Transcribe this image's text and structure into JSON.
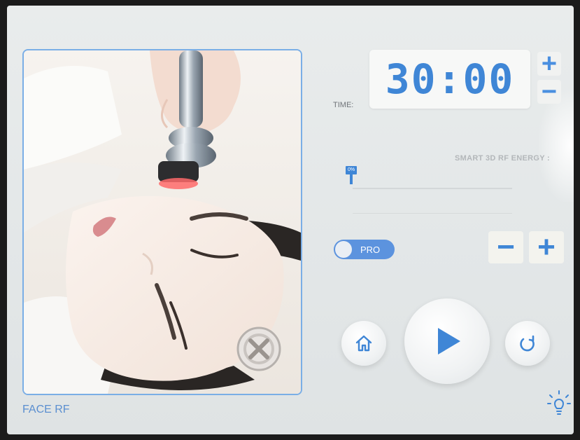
{
  "treatment": {
    "mode_label": "FACE RF"
  },
  "timer": {
    "label": "TIME:",
    "value": "30:00",
    "increment_label": "+",
    "decrement_label": "−"
  },
  "energy": {
    "label": "SMART 3D RF ENERGY :",
    "level_text": "0%",
    "level_fraction": 0.0,
    "decrease_label": "−",
    "increase_label": "+"
  },
  "pro_toggle": {
    "label": "PRO",
    "state": "on"
  },
  "controls": {
    "home": "home-icon",
    "start": "play-icon",
    "reset": "refresh-icon",
    "light": "lightbulb-icon"
  },
  "colors": {
    "accent": "#3f86d6",
    "toggle": "#5c93de",
    "frame": "#7aaee6"
  }
}
